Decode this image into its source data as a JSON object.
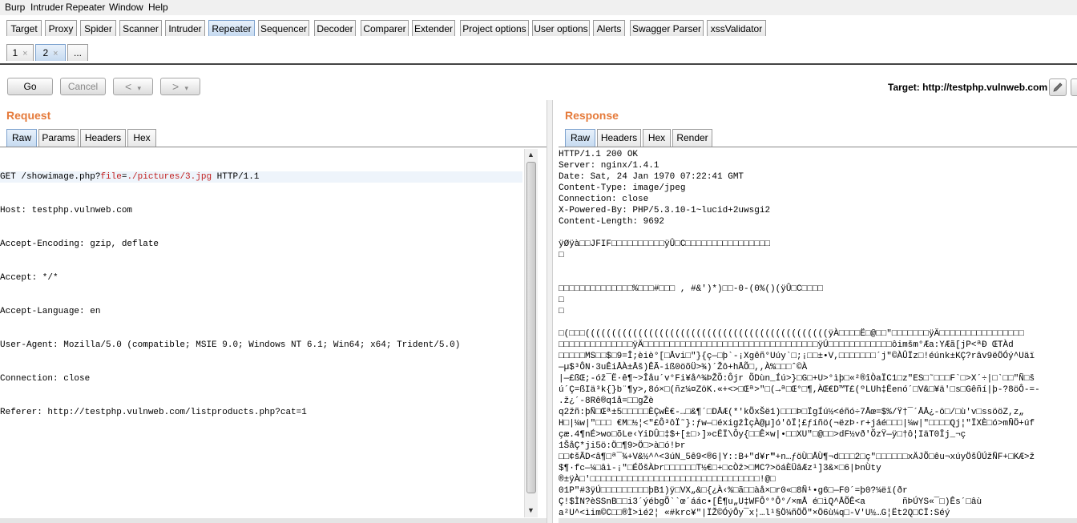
{
  "menu": [
    "Burp",
    "Intruder",
    "Repeater",
    "Window",
    "Help"
  ],
  "main_tabs": [
    "Target",
    "Proxy",
    "Spider",
    "Scanner",
    "Intruder",
    "Repeater",
    "Sequencer",
    "Decoder",
    "Comparer",
    "Extender",
    "Project options",
    "User options",
    "Alerts",
    "Swagger Parser",
    "xssValidator"
  ],
  "active_main_tab": "Repeater",
  "sub_tabs": [
    {
      "label": "1",
      "close": "×"
    },
    {
      "label": "2",
      "close": "×"
    },
    {
      "label": "..."
    }
  ],
  "toolbar": {
    "go": "Go",
    "cancel": "Cancel",
    "back": "<",
    "back_drop": "▾",
    "forward": ">",
    "forward_drop": "▾",
    "target": "Target: http://testphp.vulnweb.com"
  },
  "request": {
    "title": "Request",
    "tabs": [
      "Raw",
      "Params",
      "Headers",
      "Hex"
    ],
    "line0_a": "GET /showimage.php?",
    "line0_param": "file",
    "line0_eq": "=",
    "line0_val": "./pictures/3.jpg",
    "line0_b": " HTTP/1.1",
    "lines": [
      "Host: testphp.vulnweb.com",
      "Accept-Encoding: gzip, deflate",
      "Accept: */*",
      "Accept-Language: en",
      "User-Agent: Mozilla/5.0 (compatible; MSIE 9.0; Windows NT 6.1; Win64; x64; Trident/5.0)",
      "Connection: close",
      "Referer: http://testphp.vulnweb.com/listproducts.php?cat=1"
    ]
  },
  "response": {
    "title": "Response",
    "tabs": [
      "Raw",
      "Headers",
      "Hex",
      "Render"
    ],
    "lines": [
      "HTTP/1.1 200 OK",
      "Server: nginx/1.4.1",
      "Date: Sat, 24 Jan 1970 07:22:41 GMT",
      "Content-Type: image/jpeg",
      "Connection: close",
      "X-Powered-By: PHP/5.3.10-1~lucid+2uwsgi2",
      "Content-Length: 9692",
      "",
      "ÿØÿà□□JFIF□□□□□□□□□□ÿÛ□C□□□□□□□□□□□□□□□□",
      "□",
      "",
      "",
      "□□□□□□□□□□□□□□%□□□#□□□ , #&')*)□□-0-(0%()(ÿÛ□C□□□□",
      "□",
      "□",
      "",
      "□(□□□((((((((((((((((((((((((((((((((((((((((((((((ÿÀ□□□□Ë□@□□\"□□□□□□□ÿÄ□□□□□□□□□□□□□□□□",
      "□□□□□□□□□□□□□□ÿÄ□□□□□□□□□□□□□□□□□□□□□□□□□□□□□□□□□ÿÚ□□□□□□□□□□□□ôimšm°Æa:YÆã[jP<ªÐ ŒTÀd",
      "□□□□□MS□□$□9=Î;èiè°[□Åvi□\"}{ç—□þ`-¡Xgêñ°Uúy`□;¡□□±•V,□□□□□□□´j\"©ÀÛÏz□!éúnk±KÇ?râv9ëÖÓý^Uäï",
      "—µ$³ÔN·3uÊiÅÀ±Åš)ÊÃ-iß0öõÜ>¾)´Žô+hÅÕ□,,À%□□□ˆ©À",
      "|—£ßŒ;-óž¯Ë·ê¶~>Îåu´v°Fi¥å^¾ÞŽÕ:Ôjr ÕDùn_Íú>}□G□+U>°ìþ□«²®îÒaÏC1□z\"ES□˜□□□F`□>X´÷|□`□□\"Ñ□š",
      "ú´Ç=ßIä³k{}b¨¶y>,8ó×□(ñz¼¤ZöK.«+<>□Œª>\"□(→ª□Œ°□¶,ÀŒ€D™T£(ºLUh‡Ëenó´□V&□¥ä'□s□Gêñí|þ-?8öÔ-=-",
      ".ž¿´-8Rê®q1å=□□gŽè",
      "q2žñ:þÑ□Œª±5□□□□□ÈÇwÈ€-…□&¶´□DÅÆ(*'kÕxŠë1)□□□Þ□ÏgÍú½<éñó÷7Åœ=$%/Ÿ†¯´ÅÅ¿-ö□/□ù'v□ssööZ,z„",
      "H□|¼w|\"□□□ €M□½¦<\"£Ô³ôÏ˜}:ƒw—□éxigžÌçÀ@µ]ó'ôÏ¦£ƒíñö(¬ëzÞ·r+jáé□□□|¼w|\"□□□□Qj¦\"ÏXÈ□ó>mÑÖ+úf",
      "çæ.4¶nÉ>wo□õLe‹YiDÛ□‡$+[±□›]»cËÏ\\Ôy{□□Ê×w|•□□XU\"□@□□>dF½vð'ÕzŸ—ÿ□†ô¦IäT0Ïj_¬ç",
      "1ŠåÇ*ji5ö:Ö□¶9>Ö□>à□ó!Þr",
      "□□¢šÃD<â¶□ª¯¾+V&½^^<3úN_5ê9<®6|Y::B+″d¥r‴+n…ƒöÙ□ÅÙ¶¬d□□□2□ç\"□□□□□□xÄJÕ□êu¬xúyÖšÛÚžÑF+□KÆ>ž",
      "$¶·fc—¼□âì-¡\"□ÉÖšÀÞr□□□□□□T½€□+□cÒž>□MC?>öáÈÜâÆz¹]3&×□6|ÞnÙty",
      "®±ÿÀ□'□□□□□□□□□□□□□□□□□□□□□□□□□□□□□□□□!@□",
      "01P\"#3ÿÚ□□□□□□□□□þB1)ÿ□VX„&□{¿À‹%□ã□□àå×□r0«□8Ñ¹•g6□—F0´=þ0?¼ëï(ðr",
      "Ç!$ÌN?èSSnB□□i3´ýébgÕ``œ´áác•[Ê¶u„U‡WFÔ°°Ô°/×mÅ é□ìQ^ÅÕÊ<a       ñÞÚYS«¯□)Ês´□âù",
      "a²U^<ìim©C□□®Ì>ìé2¦ «#krc¥\"|ÏŽ©ÓýÔy¯x¦…l¹§Ö¼ñÖÕ\"×Ö6ù¼q□-V'U½…G¦Ët2Q□CÏ:Séý"
    ]
  }
}
